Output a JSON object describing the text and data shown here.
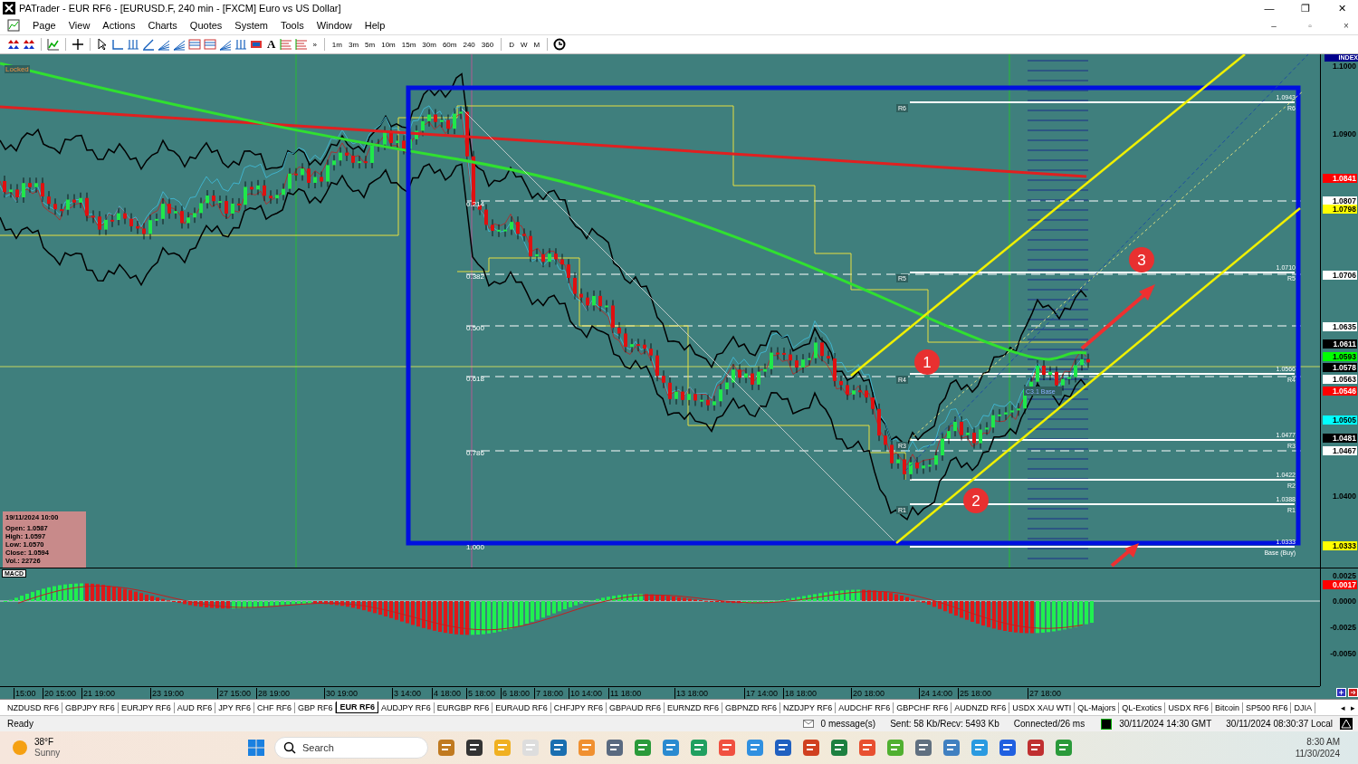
{
  "window": {
    "title": "PATrader - EUR RF6 - [EURUSD.F, 240 min - [FXCM] Euro vs US Dollar]",
    "controls": [
      "—",
      "❐",
      "✕"
    ]
  },
  "menu": {
    "items": [
      "Page",
      "View",
      "Actions",
      "Charts",
      "Quotes",
      "System",
      "Tools",
      "Window",
      "Help"
    ],
    "doc_controls": [
      "–",
      "▫",
      "×"
    ]
  },
  "toolbar": {
    "text_tool": "A",
    "more": "»",
    "timeframes": [
      "1m",
      "3m",
      "5m",
      "10m",
      "15m",
      "30m",
      "60m",
      "240",
      "360"
    ],
    "periods": [
      "D",
      "W",
      "M"
    ]
  },
  "chart": {
    "status": "Locked",
    "fib_labels": [
      "0.214",
      "0.382",
      "0.500",
      "0.618",
      "0.786",
      "1.000"
    ],
    "levels": [
      {
        "value": "1.0943",
        "name": "R6",
        "left_label": "R6"
      },
      {
        "value": "1.0710",
        "name": "R5",
        "left_label": "R5"
      },
      {
        "value": "1.0566",
        "name": "R4",
        "left_label": "R4"
      },
      {
        "value": "1.0477",
        "name": "R3",
        "left_label": "R3"
      },
      {
        "value": "1.0422",
        "name": "R2"
      },
      {
        "value": "1.0388",
        "name": "R1",
        "left_label": "R1"
      },
      {
        "value": "1.0333",
        "name": "Base (Buy)"
      }
    ],
    "markers": [
      "1",
      "2",
      "3"
    ],
    "base_label": "C3.1 Base",
    "info": {
      "date": "19/11/2024 10:00",
      "lines": [
        "Open: 1.0587",
        "High: 1.0597",
        "Low: 1.0570",
        "Close: 1.0594",
        "Vol.: 22726"
      ]
    }
  },
  "price_axis": {
    "title": "INDEX",
    "labels": [
      {
        "text": "1.1000",
        "kind": "tick"
      },
      {
        "text": "1.0900",
        "kind": "tick"
      },
      {
        "text": "1.0841",
        "kind": "tag",
        "color": "#ff0000"
      },
      {
        "text": "1.0807",
        "kind": "tag",
        "color": "#ffffff"
      },
      {
        "text": "1.0798",
        "kind": "tag",
        "color": "#ffff00"
      },
      {
        "text": "1.0706",
        "kind": "tag",
        "color": "#ffffff"
      },
      {
        "text": "1.0635",
        "kind": "tag",
        "color": "#ffffff"
      },
      {
        "text": "1.0611",
        "kind": "tag",
        "color": "#000000"
      },
      {
        "text": "1.0593",
        "kind": "tag",
        "color": "#00ff00"
      },
      {
        "text": "1.0578",
        "kind": "tag",
        "color": "#000000"
      },
      {
        "text": "1.0563",
        "kind": "tag",
        "color": "#ffffff"
      },
      {
        "text": "1.0546",
        "kind": "tag",
        "color": "#ff0000"
      },
      {
        "text": "1.0505",
        "kind": "tag",
        "color": "#00ffff"
      },
      {
        "text": "1.0481",
        "kind": "tag",
        "color": "#000000"
      },
      {
        "text": "1.0467",
        "kind": "tag",
        "color": "#ffffff"
      },
      {
        "text": "1.0400",
        "kind": "tick"
      },
      {
        "text": "1.0333",
        "kind": "tag",
        "color": "#ffff00"
      }
    ]
  },
  "macd": {
    "title": "MACD",
    "axis": [
      {
        "text": "0.0025",
        "kind": "tick"
      },
      {
        "text": "0.0017",
        "kind": "tag",
        "color": "#ff0000"
      },
      {
        "text": "0.0000",
        "kind": "tick"
      },
      {
        "text": "-0.0025",
        "kind": "tick"
      },
      {
        "text": "-0.0050",
        "kind": "tick"
      }
    ]
  },
  "time_axis": {
    "labels": [
      "15:00",
      "20 15:00",
      "21 19:00",
      "23 19:00",
      "27 15:00",
      "28 19:00",
      "30 19:00",
      "3 14:00",
      "4 18:00",
      "5 18:00",
      "6 18:00",
      "7 18:00",
      "10 14:00",
      "11 18:00",
      "13 18:00",
      "17 14:00",
      "18 18:00",
      "20 18:00",
      "24 14:00",
      "25 18:00",
      "27 18:00"
    ]
  },
  "symbol_tabs": [
    {
      "label": "NZDUSD RF6",
      "selected": false
    },
    {
      "label": "GBPJPY RF6",
      "selected": false
    },
    {
      "label": "EURJPY RF6",
      "selected": false
    },
    {
      "label": "AUD RF6",
      "selected": false
    },
    {
      "label": "JPY RF6",
      "selected": false
    },
    {
      "label": "CHF RF6",
      "selected": false
    },
    {
      "label": "GBP RF6",
      "selected": false
    },
    {
      "label": "EUR RF6",
      "selected": true
    },
    {
      "label": "AUDJPY RF6",
      "selected": false
    },
    {
      "label": "EURGBP RF6",
      "selected": false
    },
    {
      "label": "EURAUD RF6",
      "selected": false
    },
    {
      "label": "CHFJPY RF6",
      "selected": false
    },
    {
      "label": "GBPAUD RF6",
      "selected": false
    },
    {
      "label": "EURNZD RF6",
      "selected": false
    },
    {
      "label": "GBPNZD RF6",
      "selected": false
    },
    {
      "label": "NZDJPY RF6",
      "selected": false
    },
    {
      "label": "AUDCHF RF6",
      "selected": false
    },
    {
      "label": "GBPCHF RF6",
      "selected": false
    },
    {
      "label": "AUDNZD RF6",
      "selected": false
    },
    {
      "label": "USDX XAU WTI",
      "selected": false
    },
    {
      "label": "QL-Majors",
      "selected": false
    },
    {
      "label": "QL-Exotics",
      "selected": false
    },
    {
      "label": "USDX  RF6",
      "selected": false
    },
    {
      "label": "Bitcoin",
      "selected": false
    },
    {
      "label": "SP500 RF6",
      "selected": false
    },
    {
      "label": "DJIA",
      "selected": false
    }
  ],
  "tab_scroll": [
    "◂",
    "▸"
  ],
  "status_bar": {
    "text": "Ready",
    "messages": "0 message(s)",
    "traffic": "Sent: 58 Kb/Recv: 5493 Kb",
    "connection": "Connected/26 ms",
    "server_time": "30/11/2024 14:30 GMT",
    "local_time": "30/11/2024 08:30:37 Local"
  },
  "taskbar": {
    "weather": {
      "temp": "38°F",
      "condition": "Sunny"
    },
    "search": {
      "placeholder": "Search"
    },
    "time": "8:30 AM",
    "date": "11/30/2024"
  }
}
